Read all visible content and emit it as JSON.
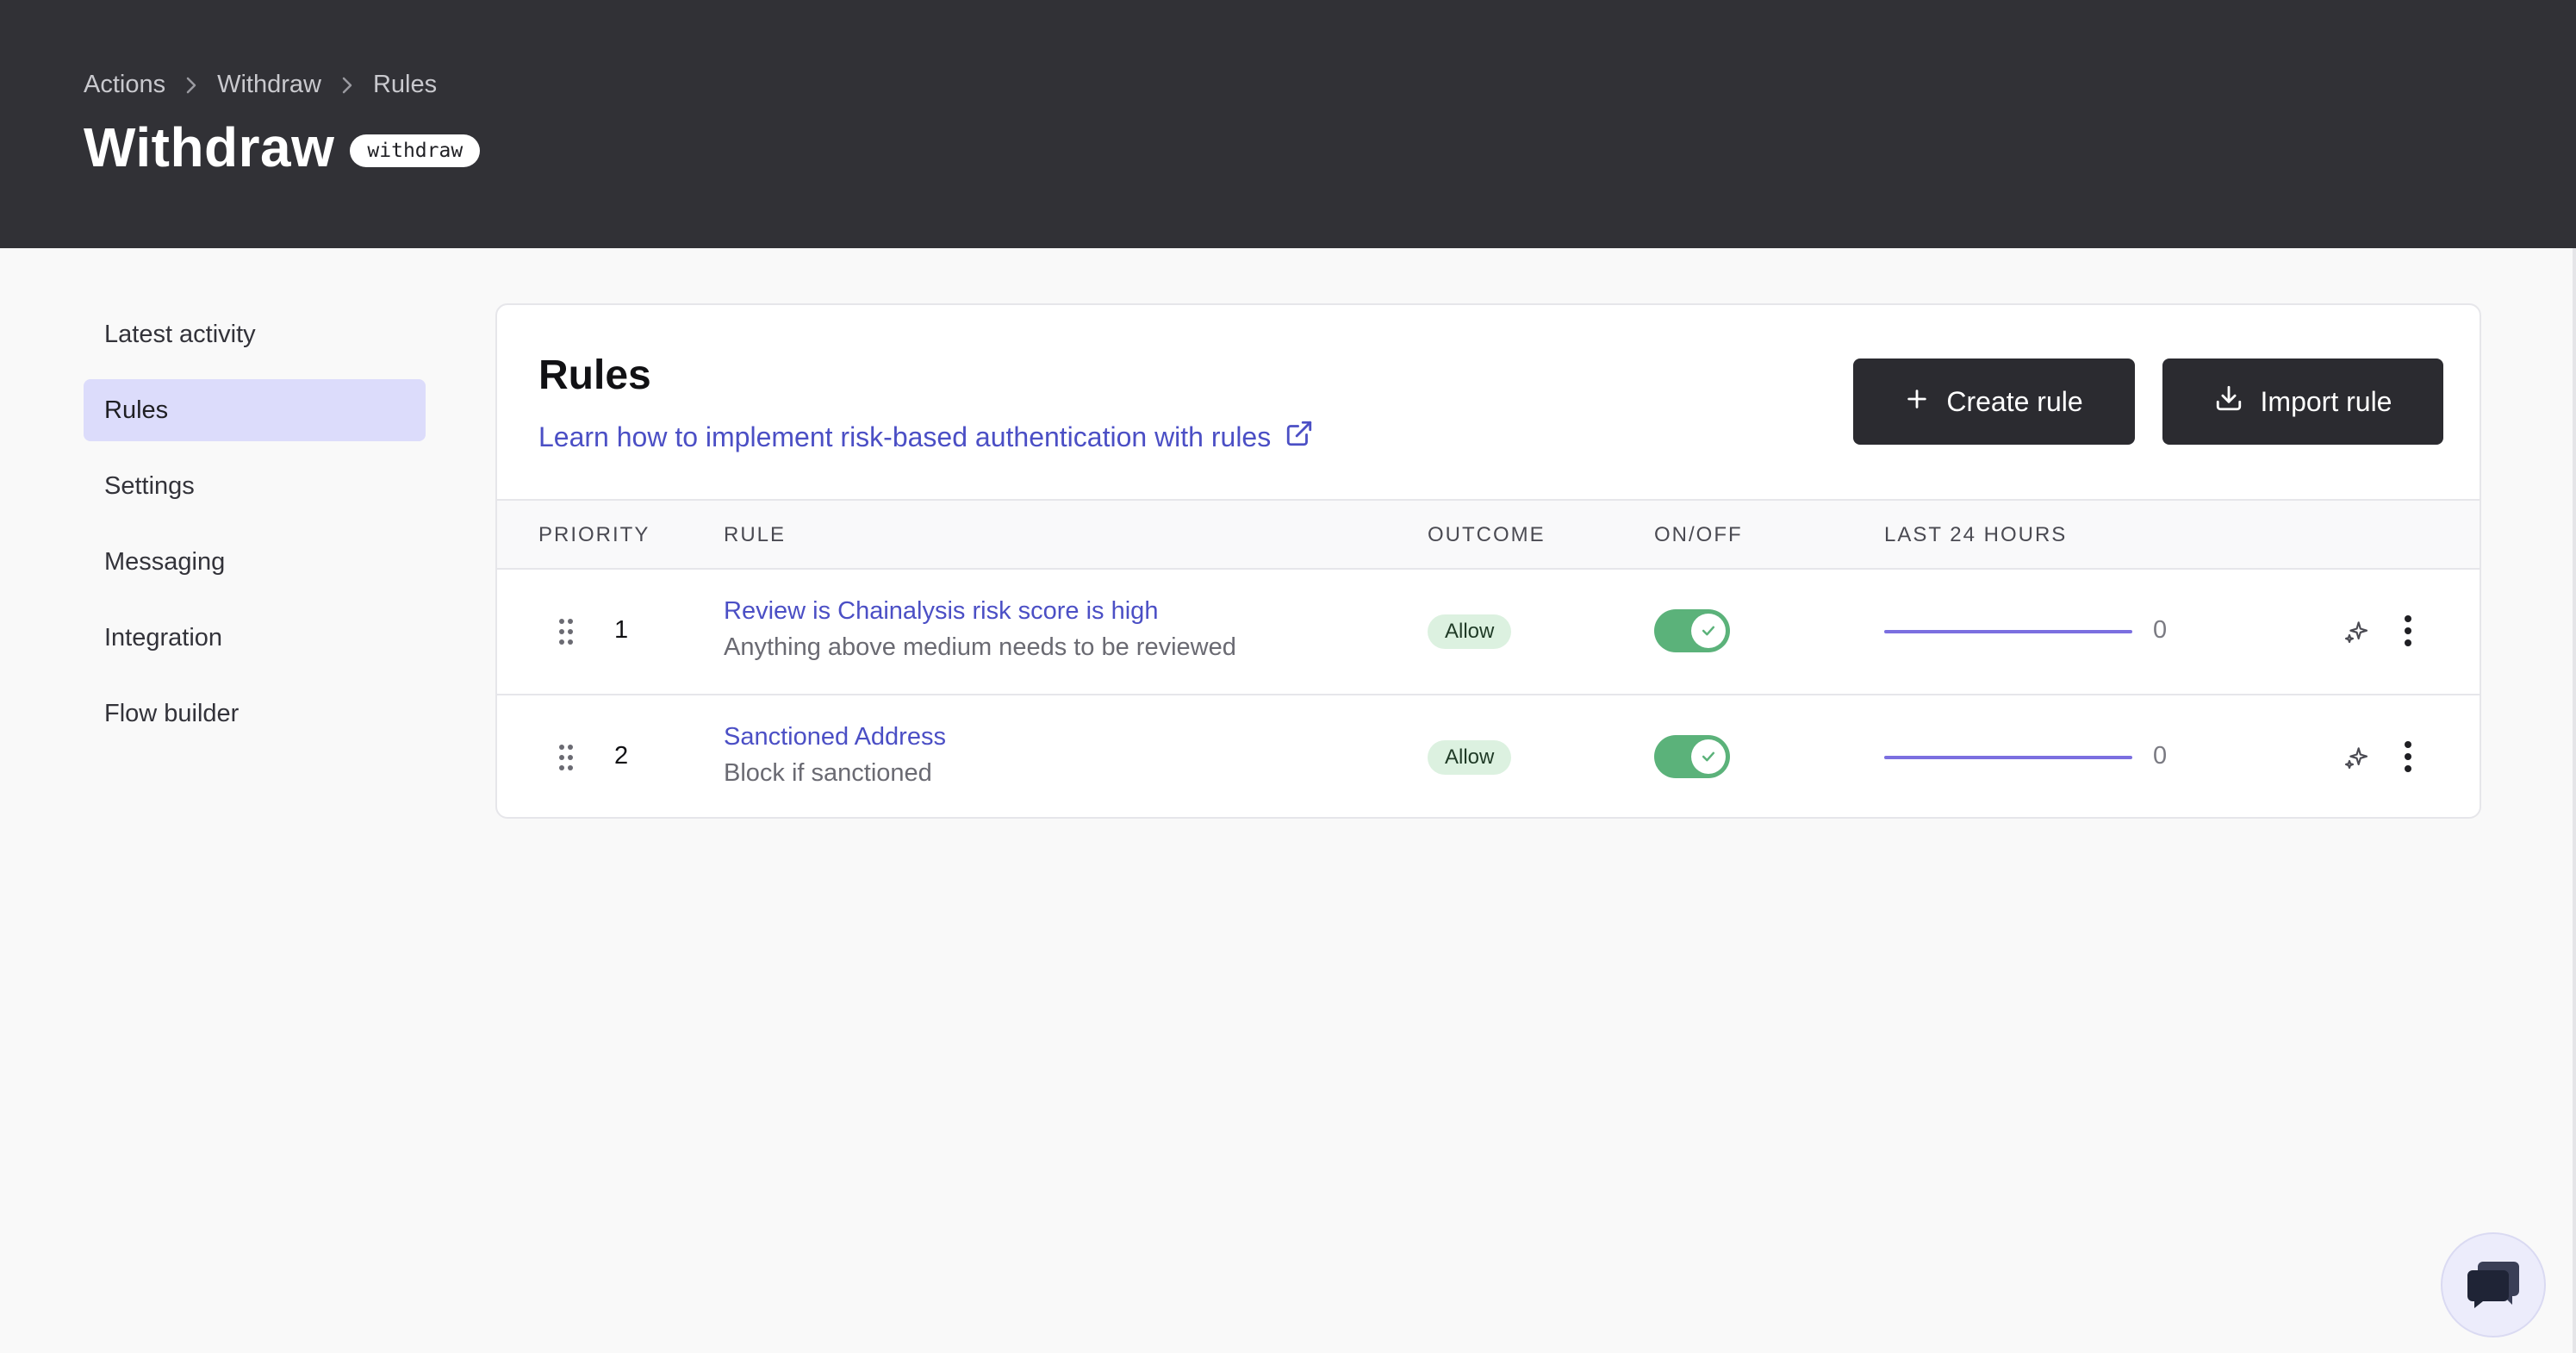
{
  "breadcrumb": [
    "Actions",
    "Withdraw",
    "Rules"
  ],
  "page": {
    "title": "Withdraw",
    "slug": "withdraw"
  },
  "sidebar": {
    "items": [
      {
        "label": "Latest activity",
        "active": false
      },
      {
        "label": "Rules",
        "active": true
      },
      {
        "label": "Settings",
        "active": false
      },
      {
        "label": "Messaging",
        "active": false
      },
      {
        "label": "Integration",
        "active": false
      },
      {
        "label": "Flow builder",
        "active": false
      }
    ]
  },
  "rules_card": {
    "title": "Rules",
    "learn_link": "Learn how to implement risk-based authentication with rules",
    "create_label": "Create rule",
    "import_label": "Import rule",
    "columns": {
      "priority": "PRIORITY",
      "rule": "RULE",
      "outcome": "OUTCOME",
      "onoff": "ON/OFF",
      "last24": "LAST 24 HOURS"
    },
    "rows": [
      {
        "priority": "1",
        "name": "Review is Chainalysis risk score is high",
        "description": "Anything above medium needs to be reviewed",
        "outcome": "Allow",
        "enabled": true,
        "count": "0"
      },
      {
        "priority": "2",
        "name": "Sanctioned Address",
        "description": "Block if sanctioned",
        "outcome": "Allow",
        "enabled": true,
        "count": "0"
      }
    ]
  },
  "colors": {
    "header_bg": "#313136",
    "accent": "#4b4fc5",
    "toggle_on": "#5bb27a",
    "sidebar_active": "#dcdcfb",
    "sparkline": "#7b6fe0"
  },
  "icons": [
    "chevron-right-icon",
    "plus-icon",
    "download-icon",
    "external-link-icon",
    "drag-handle-icon",
    "check-icon",
    "sparkles-icon",
    "more-vertical-icon",
    "chat-icon"
  ]
}
